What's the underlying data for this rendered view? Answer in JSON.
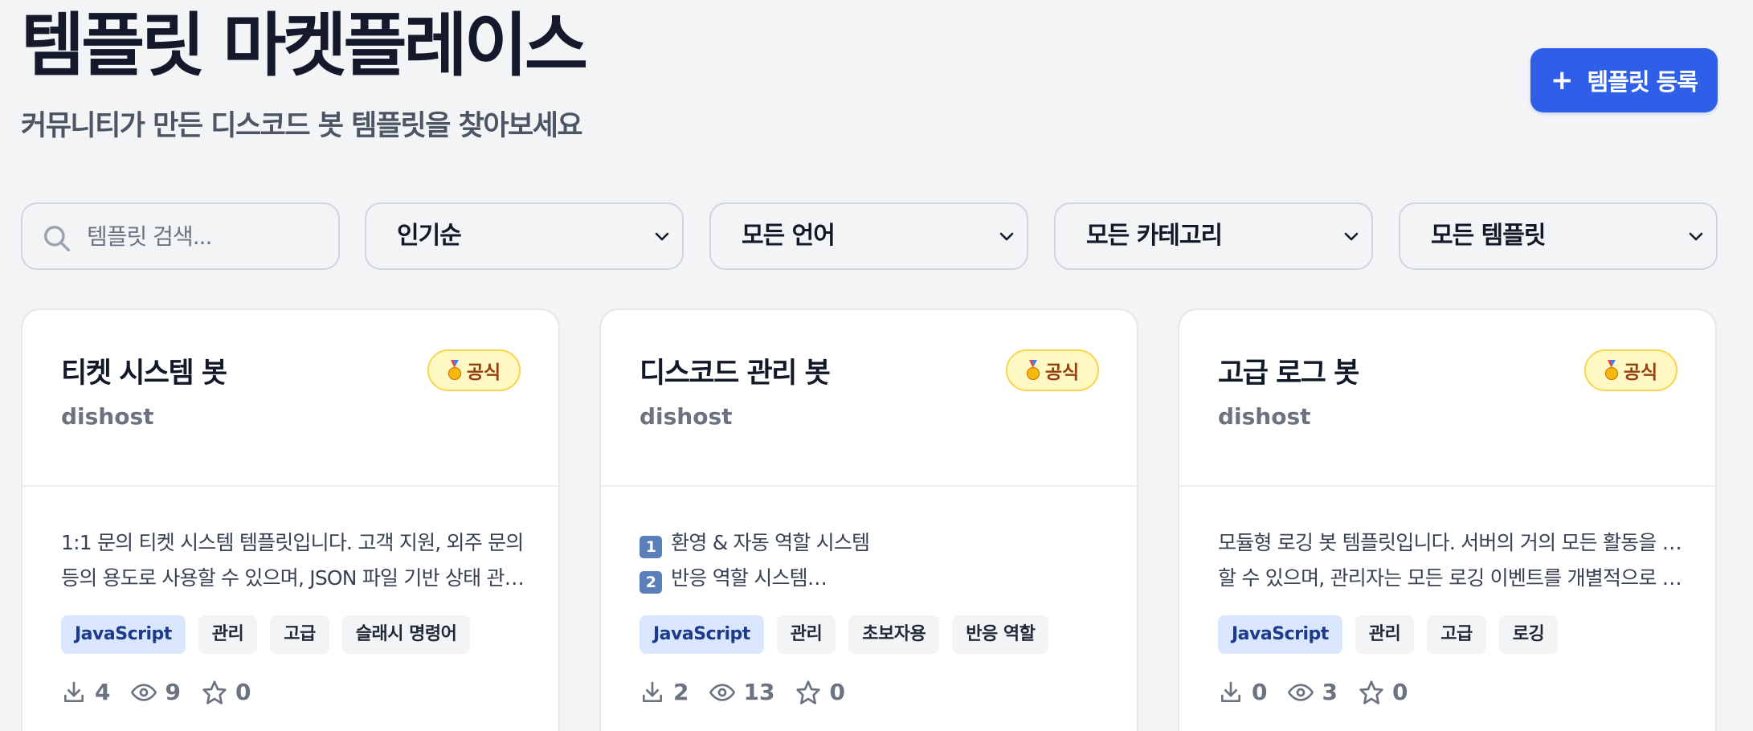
{
  "page": {
    "title": "템플릿 마켓플레이스",
    "subtitle": "커뮤니티가 만든 디스코드 봇 템플릿을 찾아보세요",
    "register_button": {
      "icon": "+",
      "label": "템플릿 등록"
    }
  },
  "colors": {
    "accent": "#2f5fe8",
    "background": "#f3f4f6",
    "badge_bg": "#fef9c3",
    "lang_tag_bg": "#dbe7fe"
  },
  "filters": {
    "search": {
      "placeholder": "템플릿 검색...",
      "value": ""
    },
    "sort": {
      "selected": "인기순"
    },
    "language": {
      "selected": "모든 언어"
    },
    "category": {
      "selected": "모든 카테고리"
    },
    "template_type": {
      "selected": "모든 템플릿"
    }
  },
  "cards": [
    {
      "title": "티켓 시스템 봇",
      "author": "dishost",
      "badge": "공식",
      "desc_lines": [
        "1:1 문의 티켓 시스템 템플릿입니다. 고객 지원, 외주 문의",
        "등의 용도로 사용할 수 있으며, JSON 파일 기반 상태 관…"
      ],
      "tags": [
        "JavaScript",
        "관리",
        "고급",
        "슬래시 명령어"
      ],
      "downloads": "4",
      "views": "9",
      "stars": "0"
    },
    {
      "title": "디스코드 관리 봇",
      "author": "dishost",
      "badge": "공식",
      "desc_items": [
        {
          "num": "1",
          "text": "환영 & 자동 역할 시스템"
        },
        {
          "num": "2",
          "text": "반응 역할 시스템…"
        }
      ],
      "tags": [
        "JavaScript",
        "관리",
        "초보자용",
        "반응 역할"
      ],
      "downloads": "2",
      "views": "13",
      "stars": "0"
    },
    {
      "title": "고급 로그 봇",
      "author": "dishost",
      "badge": "공식",
      "desc_lines": [
        "모듈형 로깅 봇 템플릿입니다. 서버의 거의 모든 활동을 로깅",
        "할 수 있으며, 관리자는 모든 로깅 이벤트를 개별적으로 켜…"
      ],
      "tags": [
        "JavaScript",
        "관리",
        "고급",
        "로깅"
      ],
      "downloads": "0",
      "views": "3",
      "stars": "0"
    }
  ]
}
